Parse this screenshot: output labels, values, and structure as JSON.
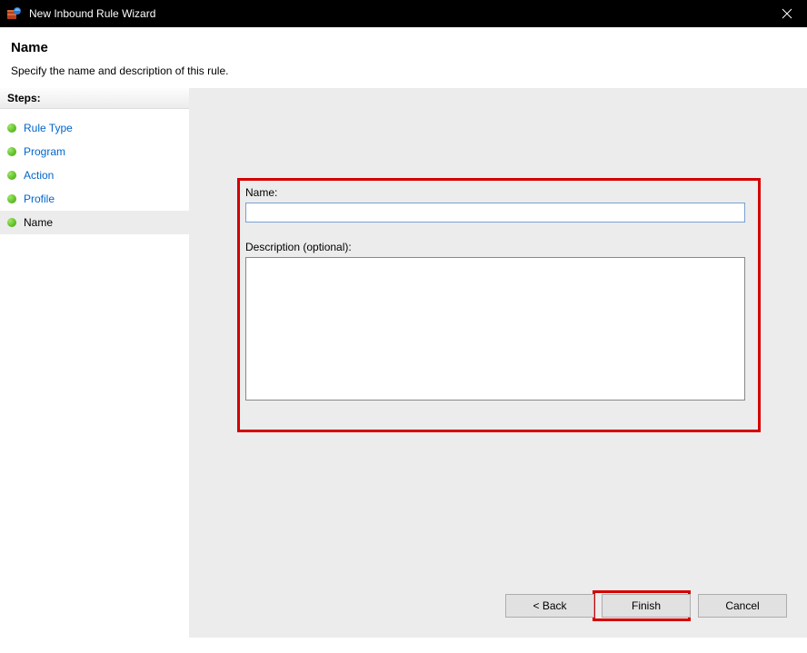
{
  "window": {
    "title": "New Inbound Rule Wizard"
  },
  "header": {
    "title": "Name",
    "description": "Specify the name and description of this rule."
  },
  "sidebar": {
    "steps_label": "Steps:",
    "items": [
      {
        "label": "Rule Type",
        "current": false
      },
      {
        "label": "Program",
        "current": false
      },
      {
        "label": "Action",
        "current": false
      },
      {
        "label": "Profile",
        "current": false
      },
      {
        "label": "Name",
        "current": true
      }
    ]
  },
  "form": {
    "name_label": "Name:",
    "name_value": "",
    "description_label": "Description (optional):",
    "description_value": ""
  },
  "buttons": {
    "back": "< Back",
    "finish": "Finish",
    "cancel": "Cancel"
  }
}
